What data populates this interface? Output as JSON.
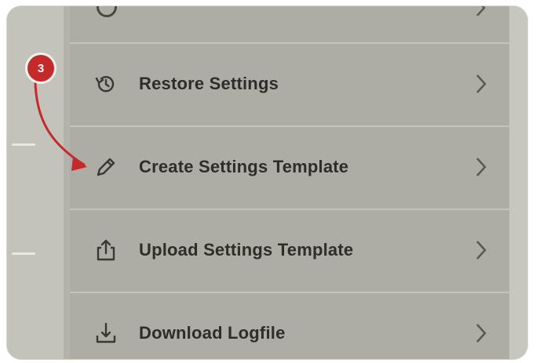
{
  "annotation": {
    "step_number": "3",
    "color": "#c42a2a"
  },
  "menu": {
    "items": [
      {
        "label": "Restore Settings",
        "icon": "restore-history-icon"
      },
      {
        "label": "Create Settings Template",
        "icon": "pencil-icon"
      },
      {
        "label": "Upload Settings Template",
        "icon": "upload-icon"
      },
      {
        "label": "Download Logfile",
        "icon": "download-icon"
      }
    ]
  },
  "colors": {
    "panel": "#aeada5",
    "text": "#2f2d2a"
  }
}
